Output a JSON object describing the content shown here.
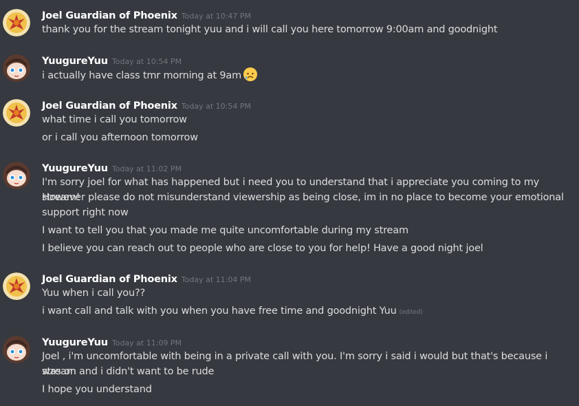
{
  "colors": {
    "background": "#36393f",
    "username": "#ffffff",
    "message_text": "#dcddde",
    "timestamp": "#72767d"
  },
  "messages": [
    {
      "author": "Joel Guardian of Phoenix",
      "timestamp": "Today at 10:47 PM",
      "avatar": "phoenix-avatar",
      "lines": [
        "thank you for the stream tonight yuu and i will call you here tomorrow 9:00am and goodnight"
      ]
    },
    {
      "author": "YuugureYuu",
      "timestamp": "Today at 10:54 PM",
      "avatar": "anime-girl-avatar",
      "lines": [
        "i actually have class tmr morning at 9am"
      ],
      "emoji": "sad-but-relieved-face-emoji"
    },
    {
      "author": "Joel Guardian of Phoenix",
      "timestamp": "Today at 10:54 PM",
      "avatar": "phoenix-avatar",
      "lines": [
        "what time i call you tomorrow",
        "or i call you afternoon tomorrow"
      ]
    },
    {
      "author": "YuugureYuu",
      "timestamp": "Today at 11:02 PM",
      "avatar": "anime-girl-avatar",
      "lines": [
        "I'm sorry joel for what has happened but i need you to understand that i appreciate you coming to my stream!",
        "However please do not misunderstand viewership as being close, im in no place to become your emotional",
        "support right now",
        "I want to tell you that you made me quite uncomfortable during my stream",
        "I believe you can reach out to people who are close to you for help! Have a good night joel"
      ]
    },
    {
      "author": "Joel Guardian of Phoenix",
      "timestamp": "Today at 11:04 PM",
      "avatar": "phoenix-avatar",
      "lines": [
        "Yuu when i call you??",
        "i want call and talk with you when you have free time and goodnight Yuu"
      ],
      "edited": "(edited)"
    },
    {
      "author": "YuugureYuu",
      "timestamp": "Today at 11:09 PM",
      "avatar": "anime-girl-avatar",
      "lines": [
        "Joel , i'm uncomfortable with being in a private call with you. I'm sorry i said i would but that's because i was on",
        "stream and i didn't want to be rude",
        "I hope you understand"
      ]
    }
  ]
}
